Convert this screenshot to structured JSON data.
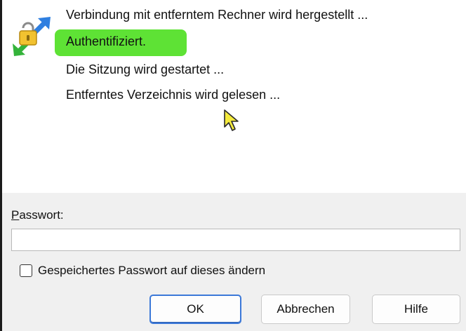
{
  "status": {
    "lines": [
      "Verbindung mit entferntem Rechner wird hergestellt ...",
      "Authentifiziert.",
      "Die Sitzung wird gestartet ...",
      "Entferntes Verzeichnis wird gelesen ..."
    ],
    "highlight_color": "#55e02a",
    "icon": "connection-lock-icon"
  },
  "password": {
    "label_access_key": "P",
    "label_rest": "asswort:",
    "value": "",
    "placeholder": ""
  },
  "checkbox": {
    "label": "Gespeichertes Passwort auf dieses ändern",
    "checked": false
  },
  "buttons": {
    "ok": "OK",
    "cancel": "Abbrechen",
    "help": "Hilfe"
  },
  "colors": {
    "accent": "#3b78d8",
    "panel_bg": "#f0f0f0"
  },
  "cursor_icon": "mouse-pointer-icon"
}
